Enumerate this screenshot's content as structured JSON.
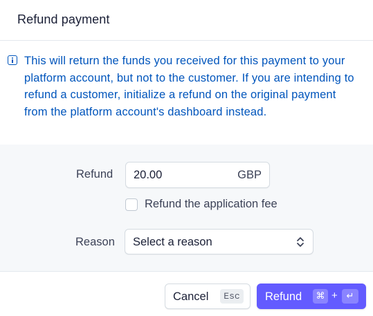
{
  "dialog": {
    "title": "Refund payment",
    "notice": "This will return the funds you received for this payment to your platform account, but not to the customer. If you are intending to refund a customer, initialize a refund on the original payment from the platform account's dashboard instead.",
    "notice_icon": "info-icon"
  },
  "form": {
    "refund_label": "Refund",
    "amount_value": "20.00",
    "currency": "GBP",
    "application_fee_label": "Refund the application fee",
    "application_fee_checked": false,
    "reason_label": "Reason",
    "reason_selected": "Select a reason"
  },
  "footer": {
    "cancel_label": "Cancel",
    "cancel_shortcut": "Esc",
    "refund_label": "Refund",
    "refund_shortcut_cmd": "⌘",
    "refund_shortcut_plus": "+",
    "refund_shortcut_enter": "↵"
  },
  "colors": {
    "primary": "#635bff",
    "notice_text": "#0055bc",
    "form_background": "#f6f8fa"
  }
}
